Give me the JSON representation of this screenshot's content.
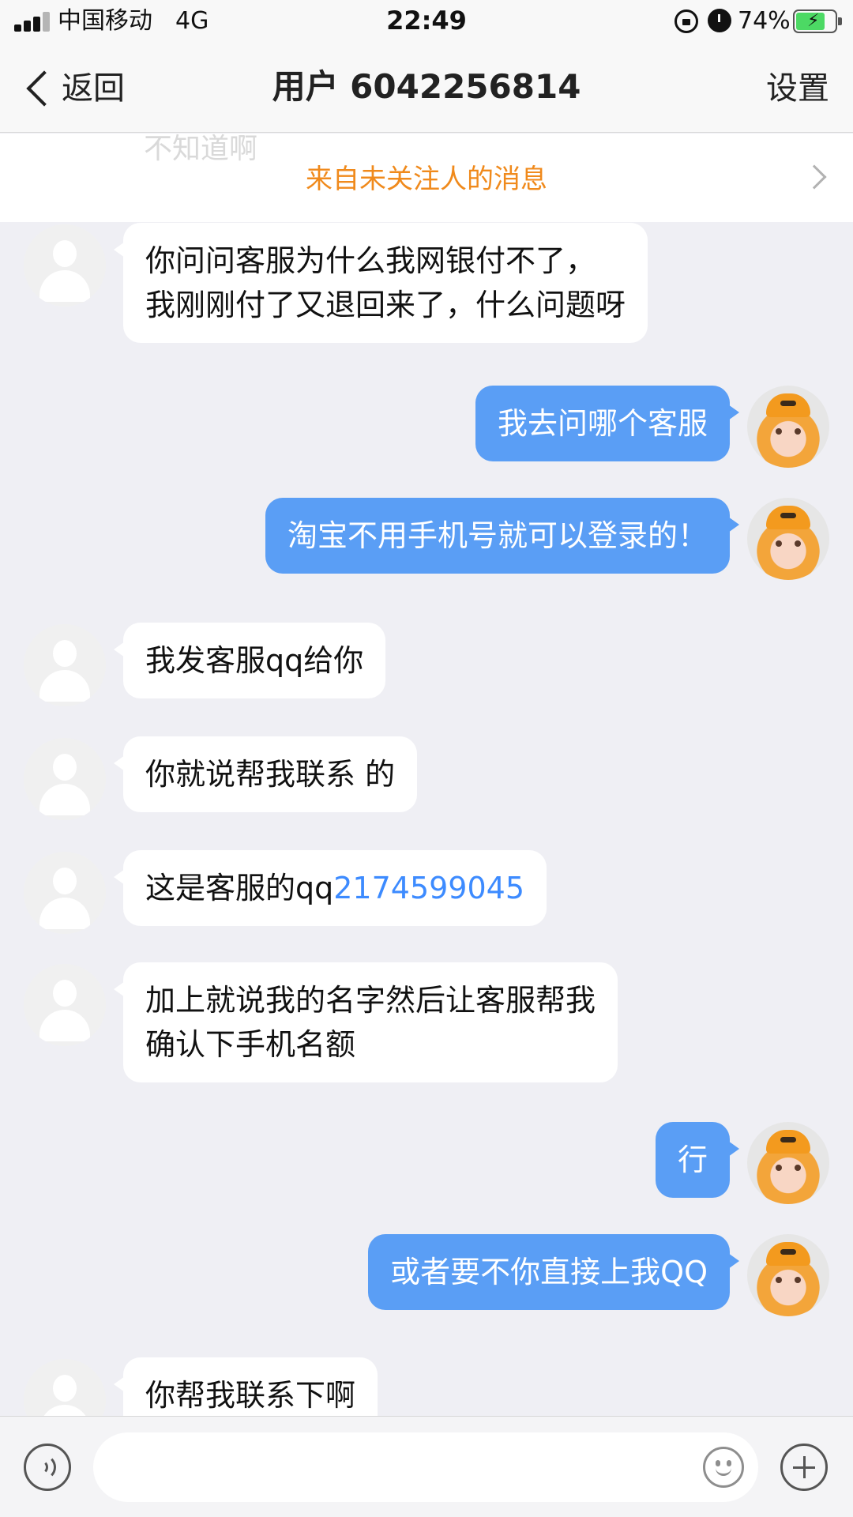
{
  "status_bar": {
    "carrier": "中国移动",
    "network": "4G",
    "time": "22:49",
    "battery_percent": "74%",
    "battery_level": 0.74,
    "icons": [
      "signal-icon",
      "orientation-lock-icon",
      "alarm-icon",
      "battery-charging-icon"
    ]
  },
  "nav": {
    "back_label": "返回",
    "title": "用户 6042256814",
    "settings_label": "设置"
  },
  "notice": {
    "ghost_text": "不知道啊",
    "text": "来自未关注人的消息"
  },
  "messages": [
    {
      "side": "in",
      "lines": [
        "你问问客服为什么我网银付不了，",
        "我刚刚付了又退回来了，什么问题呀"
      ]
    },
    {
      "side": "out",
      "text": "我去问哪个客服"
    },
    {
      "side": "out",
      "text": "淘宝不用手机号就可以登录的！"
    },
    {
      "side": "in",
      "text": "我发客服qq给你"
    },
    {
      "side": "in",
      "text": "你就说帮我联系 的"
    },
    {
      "side": "in",
      "text": "这是客服的qq",
      "link": "2174599045"
    },
    {
      "side": "in",
      "lines": [
        "加上就说我的名字然后让客服帮我",
        "确认下手机名额"
      ]
    },
    {
      "side": "out",
      "text": "行"
    },
    {
      "side": "out",
      "text": "或者要不你直接上我QQ"
    },
    {
      "side": "in",
      "text": "你帮我联系下啊"
    }
  ],
  "input_bar": {
    "placeholder": "",
    "icons": [
      "voice-icon",
      "emoji-icon",
      "plus-icon"
    ]
  },
  "colors": {
    "outgoing_bubble": "#5a9ef5",
    "notice_text": "#f08a1c",
    "link": "#3d8bff",
    "background": "#efeff4"
  }
}
